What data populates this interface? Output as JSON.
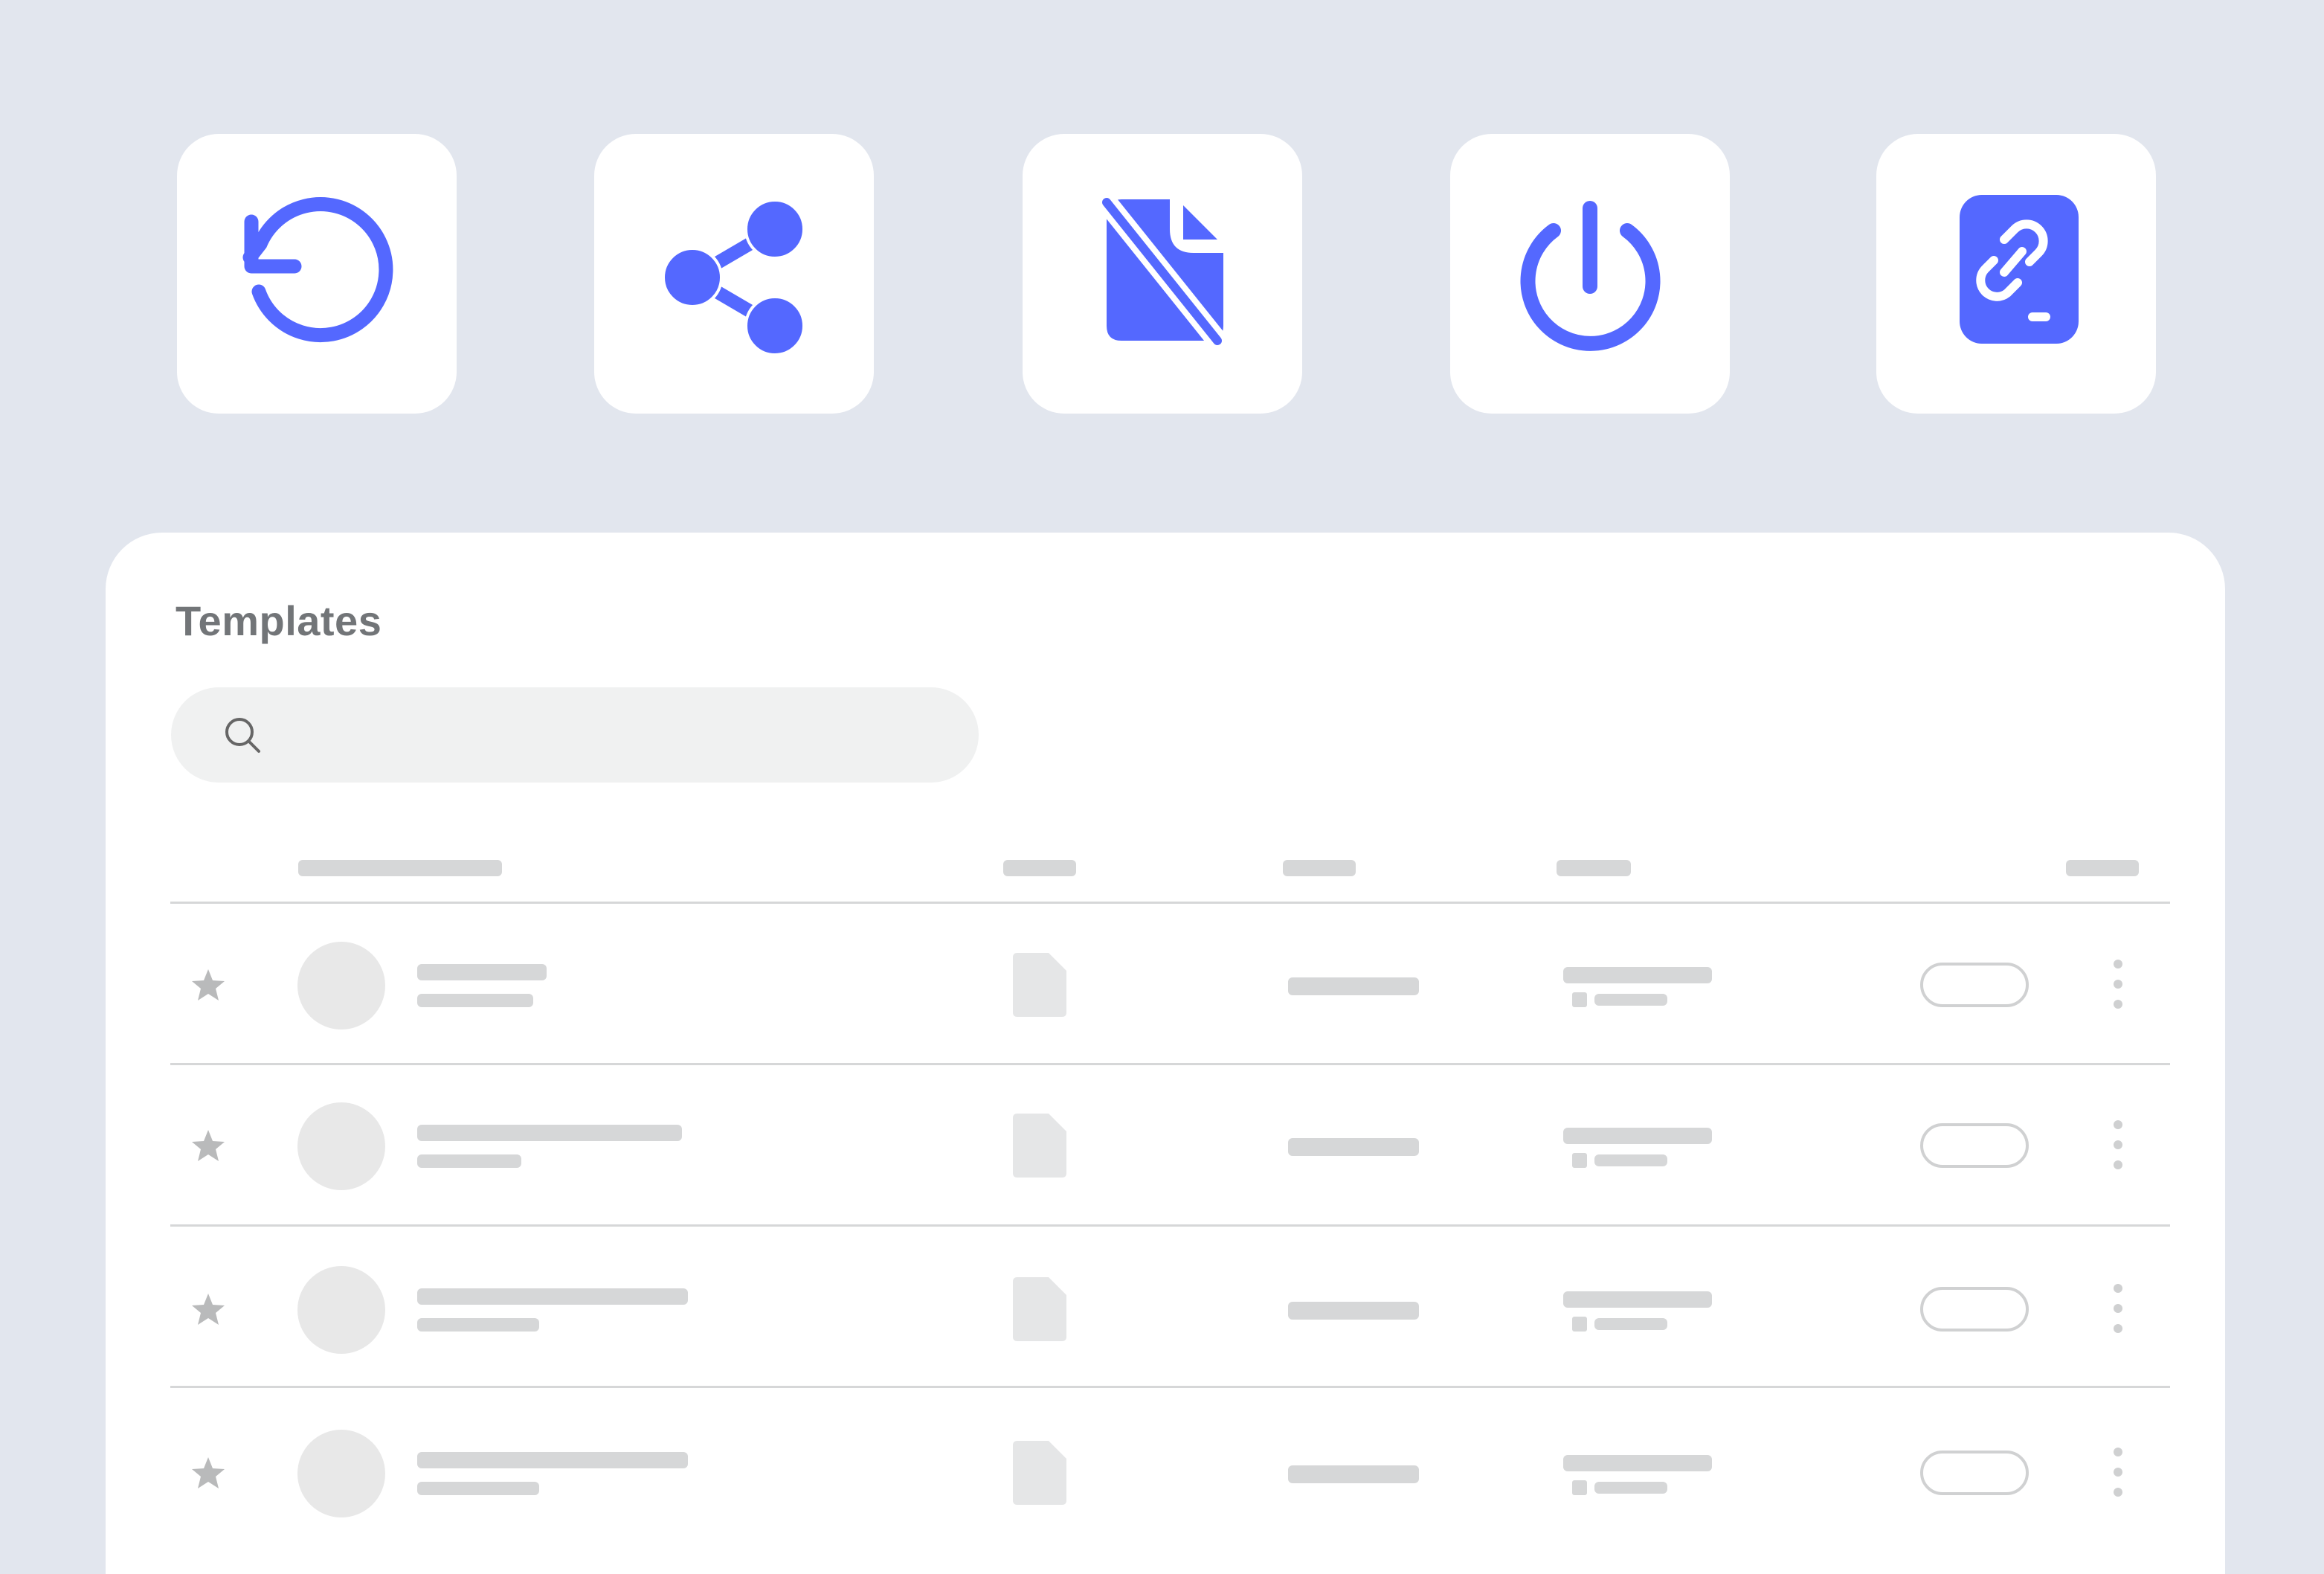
{
  "app": {
    "accent_color": "#5468ff",
    "background_color": "#e2e6ee"
  },
  "action_tiles": [
    {
      "icon": "undo-icon"
    },
    {
      "icon": "share-icon"
    },
    {
      "icon": "document-off-icon"
    },
    {
      "icon": "power-icon"
    },
    {
      "icon": "device-link-icon"
    }
  ],
  "panel": {
    "title": "Templates",
    "search": {
      "placeholder": "",
      "value": "",
      "icon": "search-icon"
    },
    "table": {
      "columns": [
        "",
        "",
        "",
        "",
        ""
      ],
      "rows": [
        {
          "starred": false,
          "icons": [
            "star-icon",
            "avatar",
            "document-icon",
            "status-pill",
            "more-options-icon"
          ]
        },
        {
          "starred": false,
          "icons": [
            "star-icon",
            "avatar",
            "document-icon",
            "status-pill",
            "more-options-icon"
          ]
        },
        {
          "starred": false,
          "icons": [
            "star-icon",
            "avatar",
            "document-icon",
            "status-pill",
            "more-options-icon"
          ]
        },
        {
          "starred": false,
          "icons": [
            "star-icon",
            "avatar",
            "document-icon",
            "status-pill",
            "more-options-icon"
          ]
        }
      ]
    }
  }
}
